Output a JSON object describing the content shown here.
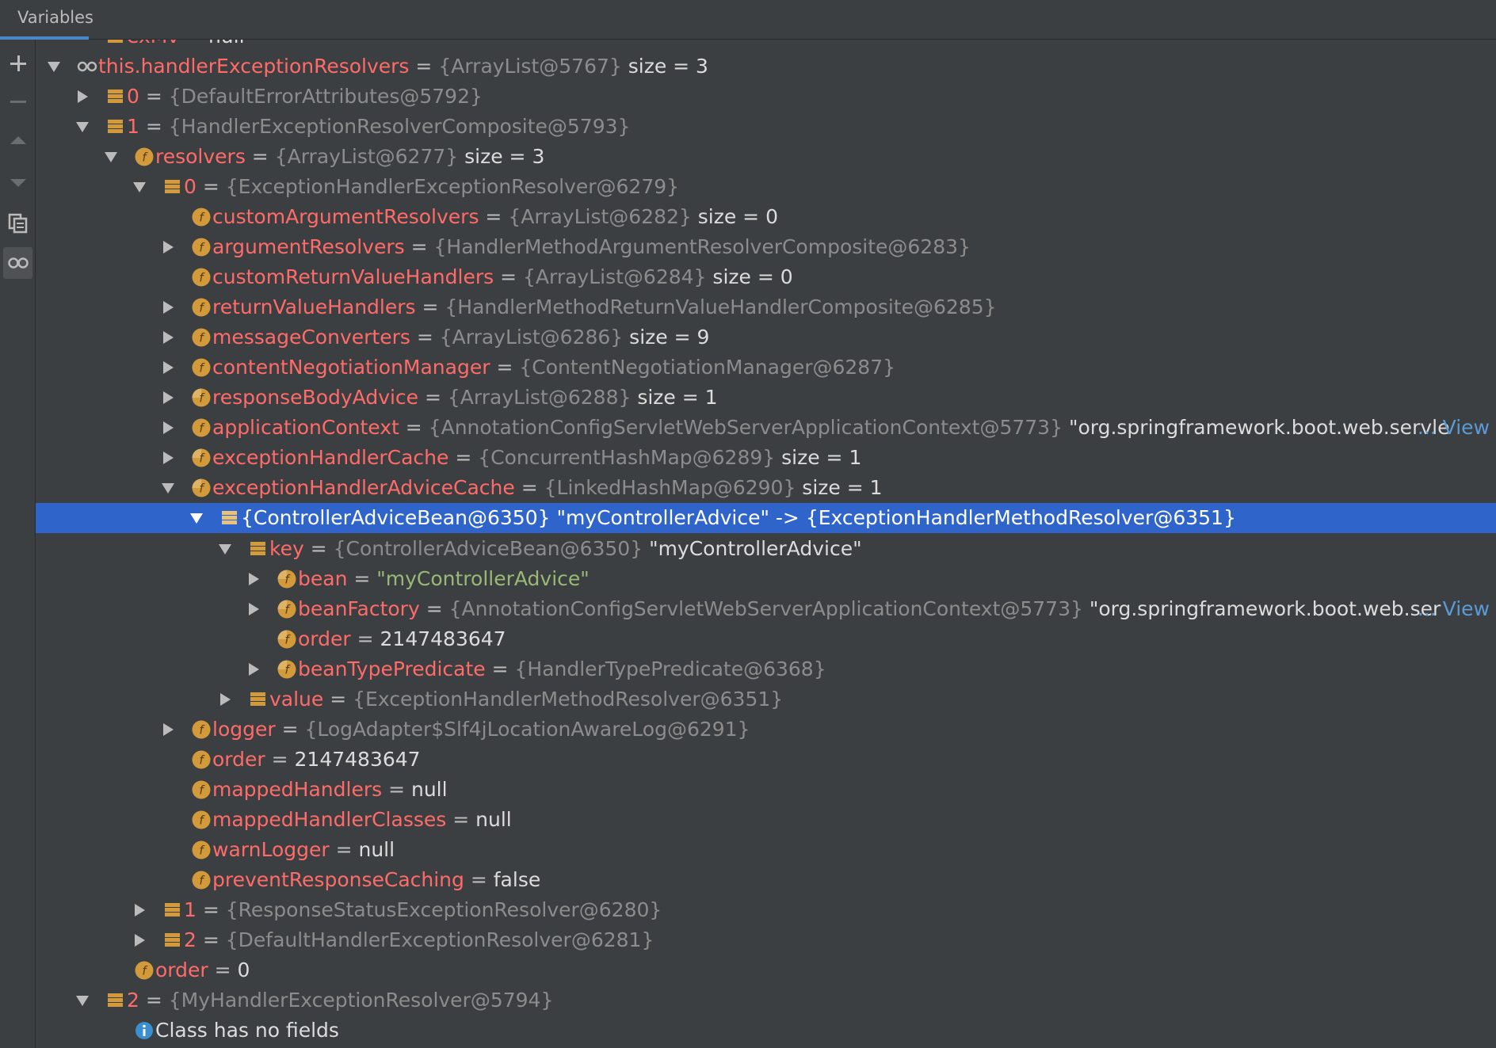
{
  "panel": {
    "title": "Variables",
    "colors": {
      "background": "#3c3f41",
      "name": "#ff6b68",
      "reference": "#8c8c8c",
      "string": "#9ab974",
      "selection": "#2f65ca",
      "field_icon": "#d29a3b",
      "link": "#5a9bd6"
    }
  },
  "toolbar": [
    {
      "name": "add-watch-button",
      "icon": "plus-icon"
    },
    {
      "name": "remove-watch-button",
      "icon": "minus-icon"
    },
    {
      "name": "move-up-button",
      "icon": "arrow-up-icon"
    },
    {
      "name": "move-down-button",
      "icon": "arrow-down-icon"
    },
    {
      "name": "copy-button",
      "icon": "copy-icon"
    },
    {
      "name": "show-watches-button",
      "icon": "glasses-icon"
    }
  ],
  "rows": [
    {
      "indent": 1,
      "toggle": "none",
      "icon": "list",
      "name": "exMv",
      "eq": " = ",
      "value": "null",
      "valueClass": "v"
    },
    {
      "indent": 0,
      "toggle": "expanded",
      "icon": "watch",
      "name": "this.handlerExceptionResolvers",
      "eq": " = ",
      "ref": "{ArrayList@5767}",
      "extra": "  size = 3"
    },
    {
      "indent": 1,
      "toggle": "collapsed",
      "icon": "list",
      "name": "0",
      "eq": " = ",
      "ref": "{DefaultErrorAttributes@5792}"
    },
    {
      "indent": 1,
      "toggle": "expanded",
      "icon": "list",
      "name": "1",
      "eq": " = ",
      "ref": "{HandlerExceptionResolverComposite@5793}"
    },
    {
      "indent": 2,
      "toggle": "expanded",
      "icon": "field",
      "name": "resolvers",
      "eq": " = ",
      "ref": "{ArrayList@6277}",
      "extra": "  size = 3"
    },
    {
      "indent": 3,
      "toggle": "expanded",
      "icon": "list",
      "name": "0",
      "eq": " = ",
      "ref": "{ExceptionHandlerExceptionResolver@6279}"
    },
    {
      "indent": 4,
      "toggle": "none",
      "icon": "field",
      "name": "customArgumentResolvers",
      "eq": " = ",
      "ref": "{ArrayList@6282}",
      "extra": "  size = 0"
    },
    {
      "indent": 4,
      "toggle": "collapsed",
      "icon": "field",
      "name": "argumentResolvers",
      "eq": " = ",
      "ref": "{HandlerMethodArgumentResolverComposite@6283}"
    },
    {
      "indent": 4,
      "toggle": "none",
      "icon": "field",
      "name": "customReturnValueHandlers",
      "eq": " = ",
      "ref": "{ArrayList@6284}",
      "extra": "  size = 0"
    },
    {
      "indent": 4,
      "toggle": "collapsed",
      "icon": "field",
      "name": "returnValueHandlers",
      "eq": " = ",
      "ref": "{HandlerMethodReturnValueHandlerComposite@6285}"
    },
    {
      "indent": 4,
      "toggle": "collapsed",
      "icon": "field",
      "name": "messageConverters",
      "eq": " = ",
      "ref": "{ArrayList@6286}",
      "extra": "  size = 9"
    },
    {
      "indent": 4,
      "toggle": "collapsed",
      "icon": "field",
      "name": "contentNegotiationManager",
      "eq": " = ",
      "ref": "{ContentNegotiationManager@6287}"
    },
    {
      "indent": 4,
      "toggle": "collapsed",
      "icon": "field-final",
      "name": "responseBodyAdvice",
      "eq": " = ",
      "ref": "{ArrayList@6288}",
      "extra": "  size = 1"
    },
    {
      "indent": 4,
      "toggle": "collapsed",
      "icon": "field",
      "name": "applicationContext",
      "eq": " = ",
      "ref": "{AnnotationConfigServletWebServerApplicationContext@5773}",
      "extra": " \"org.springframework.boot.web.servle",
      "view": "View",
      "viewDots": "..."
    },
    {
      "indent": 4,
      "toggle": "collapsed",
      "icon": "field-final",
      "name": "exceptionHandlerCache",
      "eq": " = ",
      "ref": "{ConcurrentHashMap@6289}",
      "extra": "  size = 1"
    },
    {
      "indent": 4,
      "toggle": "expanded",
      "icon": "field-final",
      "name": "exceptionHandlerAdviceCache",
      "eq": " = ",
      "ref": "{LinkedHashMap@6290}",
      "extra": "  size = 1"
    },
    {
      "indent": 5,
      "toggle": "expanded",
      "icon": "list",
      "selected": true,
      "name": "",
      "eq": "",
      "value": "{ControllerAdviceBean@6350} \"myControllerAdvice\" -> {ExceptionHandlerMethodResolver@6351}",
      "valueClass": "v"
    },
    {
      "indent": 6,
      "toggle": "expanded",
      "icon": "list",
      "name": "key",
      "eq": " = ",
      "ref": "{ControllerAdviceBean@6350}",
      "extra": " \"myControllerAdvice\""
    },
    {
      "indent": 7,
      "toggle": "collapsed",
      "icon": "field-final",
      "name": "bean",
      "eq": " = ",
      "value": "\"myControllerAdvice\"",
      "valueClass": "str"
    },
    {
      "indent": 7,
      "toggle": "collapsed",
      "icon": "field-final",
      "name": "beanFactory",
      "eq": " = ",
      "ref": "{AnnotationConfigServletWebServerApplicationContext@5773}",
      "extra": " \"org.springframework.boot.web.ser",
      "view": "View",
      "viewDots": "..."
    },
    {
      "indent": 7,
      "toggle": "none",
      "icon": "field-final",
      "name": "order",
      "eq": " = ",
      "value": "2147483647",
      "valueClass": "v"
    },
    {
      "indent": 7,
      "toggle": "collapsed",
      "icon": "field-final",
      "name": "beanTypePredicate",
      "eq": " = ",
      "ref": "{HandlerTypePredicate@6368}"
    },
    {
      "indent": 6,
      "toggle": "collapsed",
      "icon": "list",
      "name": "value",
      "eq": " = ",
      "ref": "{ExceptionHandlerMethodResolver@6351}"
    },
    {
      "indent": 4,
      "toggle": "collapsed",
      "icon": "field",
      "name": "logger",
      "eq": " = ",
      "ref": "{LogAdapter$Slf4jLocationAwareLog@6291}"
    },
    {
      "indent": 4,
      "toggle": "none",
      "icon": "field",
      "name": "order",
      "eq": " = ",
      "value": "2147483647",
      "valueClass": "v"
    },
    {
      "indent": 4,
      "toggle": "none",
      "icon": "field",
      "name": "mappedHandlers",
      "eq": " = ",
      "value": "null",
      "valueClass": "v"
    },
    {
      "indent": 4,
      "toggle": "none",
      "icon": "field",
      "name": "mappedHandlerClasses",
      "eq": " = ",
      "value": "null",
      "valueClass": "v"
    },
    {
      "indent": 4,
      "toggle": "none",
      "icon": "field",
      "name": "warnLogger",
      "eq": " = ",
      "value": "null",
      "valueClass": "v"
    },
    {
      "indent": 4,
      "toggle": "none",
      "icon": "field",
      "name": "preventResponseCaching",
      "eq": " = ",
      "value": "false",
      "valueClass": "v"
    },
    {
      "indent": 3,
      "toggle": "collapsed",
      "icon": "list",
      "name": "1",
      "eq": " = ",
      "ref": "{ResponseStatusExceptionResolver@6280}"
    },
    {
      "indent": 3,
      "toggle": "collapsed",
      "icon": "list",
      "name": "2",
      "eq": " = ",
      "ref": "{DefaultHandlerExceptionResolver@6281}"
    },
    {
      "indent": 2,
      "toggle": "none",
      "icon": "field",
      "name": "order",
      "eq": " = ",
      "value": "0",
      "valueClass": "v"
    },
    {
      "indent": 1,
      "toggle": "expanded",
      "icon": "list",
      "name": "2",
      "eq": " = ",
      "ref": "{MyHandlerExceptionResolver@5794}"
    },
    {
      "indent": 2,
      "toggle": "none",
      "icon": "info",
      "name": "",
      "eq": "",
      "value": "Class has no fields",
      "valueClass": "v"
    }
  ]
}
